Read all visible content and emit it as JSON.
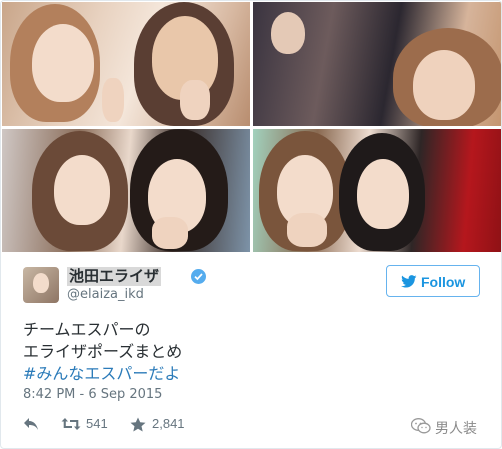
{
  "tweet": {
    "author": {
      "display_name": "池田エライザ",
      "handle": "@elaiza_ikd",
      "verified": true
    },
    "follow_button": {
      "label": "Follow"
    },
    "text_lines": [
      "チームエスパーの",
      "エライザポーズまとめ"
    ],
    "hashtag": "#みんなエスパーだよ",
    "timestamp": "8:42 PM - 6 Sep 2015",
    "actions": {
      "reply_icon": "reply-icon",
      "retweet_icon": "retweet-icon",
      "retweet_count": "541",
      "like_icon": "star-icon",
      "like_count": "2,841"
    }
  },
  "photos": [
    "photo-1",
    "photo-2",
    "photo-3",
    "photo-4"
  ],
  "watermark": {
    "text": "男人装",
    "icon": "wechat-icon"
  },
  "colors": {
    "twitter_blue": "#1b95e0",
    "verified_blue": "#55acee",
    "hashtag_blue": "#2b7bb9",
    "text_dark": "#292f33",
    "text_muted": "#66757f",
    "border": "#e1e8ed"
  }
}
